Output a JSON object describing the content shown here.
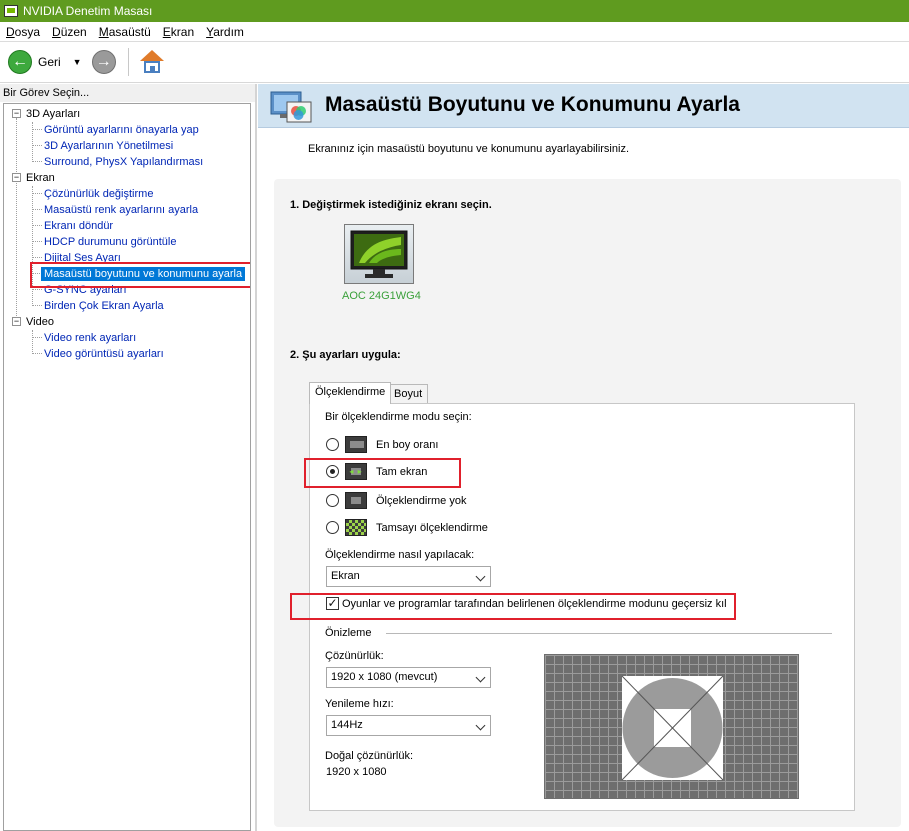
{
  "window": {
    "title": "NVIDIA Denetim Masası"
  },
  "menu": [
    "Dosya",
    "Düzen",
    "Masaüstü",
    "Ekran",
    "Yardım"
  ],
  "toolbar": {
    "back_label": "Geri"
  },
  "left": {
    "header": "Bir Görev Seçin...",
    "categories": [
      {
        "label": "3D Ayarları",
        "items": [
          "Görüntü ayarlarını önayarla yap",
          "3D Ayarlarının Yönetilmesi",
          "Surround, PhysX Yapılandırması"
        ]
      },
      {
        "label": "Ekran",
        "items": [
          "Çözünürlük değiştirme",
          "Masaüstü renk ayarlarını ayarla",
          "Ekranı döndür",
          "HDCP durumunu görüntüle",
          "Dijital Ses Ayarı",
          "Masaüstü boyutunu ve konumunu ayarla",
          "G-SYNC ayarları",
          "Birden Çok Ekran Ayarla"
        ]
      },
      {
        "label": "Video",
        "items": [
          "Video renk ayarları",
          "Video görüntüsü ayarları"
        ]
      }
    ]
  },
  "main": {
    "title": "Masaüstü Boyutunu ve Konumunu Ayarla",
    "intro": "Ekranınız için masaüstü boyutunu ve konumunu ayarlayabilirsiniz.",
    "step1": "1. Değiştirmek istediğiniz ekranı seçin.",
    "monitor_label": "AOC 24G1WG4",
    "step2": "2. Şu ayarları uygula:",
    "tabs": [
      "Ölçeklendirme",
      "Boyut"
    ],
    "scaling": {
      "prompt": "Bir ölçeklendirme modu seçin:",
      "modes": [
        "En boy oranı",
        "Tam ekran",
        "Ölçeklendirme yok",
        "Tamsayı ölçeklendirme"
      ],
      "selected_mode": "Tam ekran",
      "how_label": "Ölçeklendirme nasıl yapılacak:",
      "how_value": "Ekran",
      "override_label": "Oyunlar ve programlar tarafından belirlenen ölçeklendirme modunu geçersiz kıl",
      "override_checked": true
    },
    "preview": {
      "heading": "Önizleme",
      "resolution_label": "Çözünürlük:",
      "resolution_value": "1920 x 1080 (mevcut)",
      "refresh_label": "Yenileme hızı:",
      "refresh_value": "144Hz",
      "native_label": "Doğal çözünürlük:",
      "native_value": "1920 x 1080"
    }
  },
  "colors": {
    "nvidia_green": "#76b900",
    "titlebar": "#5f9b1f",
    "highlight_box": "#e0202c",
    "selection": "#0078d7"
  }
}
